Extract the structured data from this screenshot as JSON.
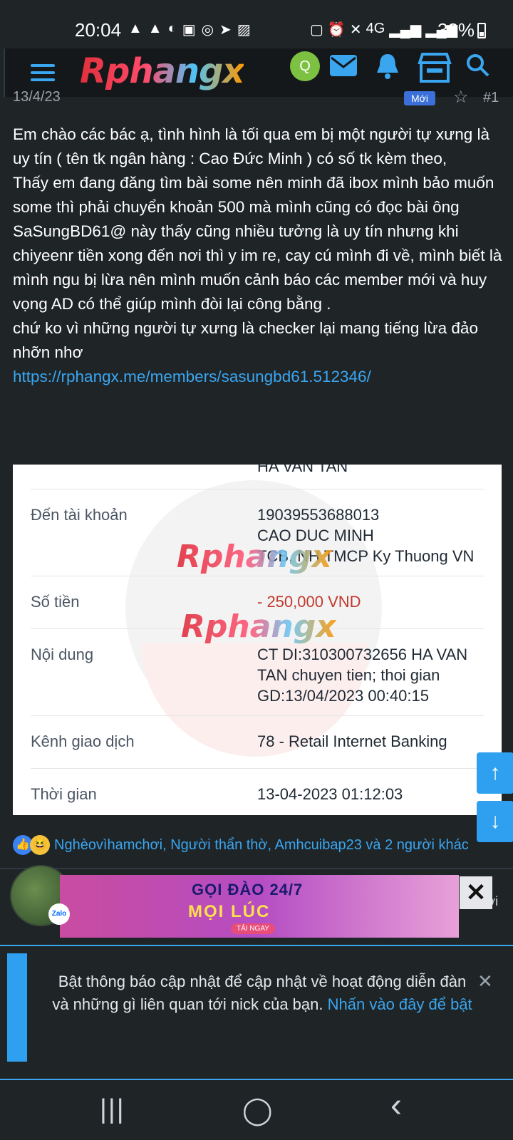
{
  "status_bar": {
    "time": "20:04",
    "battery_percent": "32%",
    "left_icons": [
      "warning-icon",
      "warning-icon",
      "messenger-icon",
      "zalo-icon",
      "chrome-icon",
      "telegram-icon",
      "gallery-icon"
    ],
    "right_icons": [
      "battery-saver-icon",
      "alarm-icon",
      "mute-icon",
      "4g-icon",
      "signal-icon",
      "signal-icon"
    ],
    "network_label": "4G"
  },
  "header": {
    "logo_text": "Rphangx",
    "avatar_letter": "Q",
    "icons": [
      "menu-icon",
      "mail-icon",
      "bell-icon",
      "store-icon",
      "search-icon"
    ]
  },
  "post": {
    "date": "13/4/23",
    "badge": "Mới",
    "number": "#1",
    "paragraphs": [
      "Em chào các bác ạ, tình hình là tối qua em bị một người tự xưng là uy tín ( tên tk ngân hàng : Cao Đức Minh ) có số tk kèm theo,",
      "Thấy em đang đăng tìm bài some nên minh đã ibox mình bảo muốn some thì phải chuyển khoản 500 mà mình cũng có đọc bài ông SaSungBD61@ này thấy cũng nhiều tưởng là uy tín nhưng khi chiyeenr tiền xong đến nơi thì y im re, cay cú mình đi về, mình biết là mình ngu bị lừa nên mình muốn cảnh báo các member mới và huy vọng AD có thể giúp mình đòi lại công bằng .",
      "chứ ko vì những người tự xưng là checker lại mang tiếng lừa đảo nhỡn nhơ"
    ],
    "link": "https://rphangx.me/members/sasungbd61.512346/"
  },
  "receipt": {
    "top_partial": "HA VAN TAN",
    "watermark": "Rphangx",
    "rows": [
      {
        "label": "Đến tài khoản",
        "value_lines": [
          "19039553688013",
          "CAO DUC MINH",
          "TCB, NH TMCP Ky Thuong VN"
        ]
      },
      {
        "label": "Số tiền",
        "value_lines": [
          "- 250,000 VND"
        ]
      },
      {
        "label": "Nội dung",
        "value_lines": [
          "CT DI:310300732656 HA VAN",
          "TAN chuyen tien; thoi gian",
          "GD:13/04/2023 00:40:15"
        ]
      },
      {
        "label": "Kênh giao dịch",
        "value_lines": [
          "78 - Retail Internet Banking"
        ]
      },
      {
        "label": "Thời gian",
        "value_lines": [
          "13-04-2023 01:12:03"
        ]
      }
    ]
  },
  "reactions": {
    "text": "Nghèovìhamchơi, Người thẩn thờ, Amhcuibap23 và 2 người khác"
  },
  "ad": {
    "title": "GỌI ĐÀO 24/7",
    "subtitle": "MỌI LÚC",
    "cta": "TẢI NGAY",
    "close": "✕",
    "reply_partial": "Trả lời"
  },
  "user": {
    "zalo_badge": "Zalo"
  },
  "notification": {
    "text": "Bật thông báo cập nhật để cập nhật về hoạt động diễn đàn và những gì liên quan tới nick của bạn.",
    "link_text": "Nhấn vào đây để bật",
    "close": "✕"
  },
  "scroll": {
    "up": "↑",
    "down": "↓"
  },
  "nav": {
    "recents": "|||",
    "home": "◯",
    "back": "‹"
  }
}
